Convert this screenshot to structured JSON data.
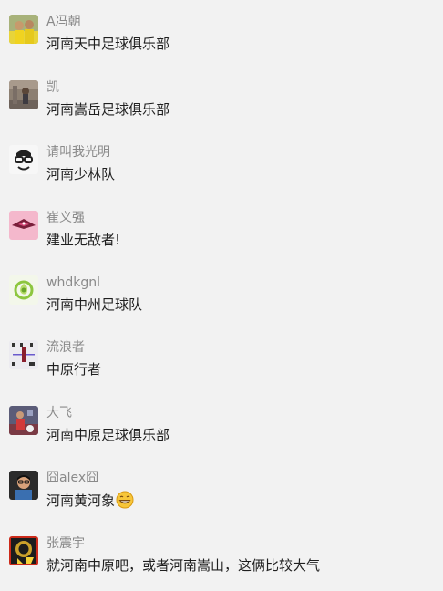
{
  "comments": [
    {
      "name": "A冯朝",
      "text": "河南天中足球俱乐部",
      "avatar_icon": "avatar-two-people-yellow"
    },
    {
      "name": "凯",
      "text": "河南嵩岳足球俱乐部",
      "avatar_icon": "avatar-person-photo"
    },
    {
      "name": "请叫我光明",
      "text": "河南少林队",
      "avatar_icon": "avatar-glasses-cartoon"
    },
    {
      "name": "崔义强",
      "text": "建业无敌者!",
      "avatar_icon": "avatar-pink-bird"
    },
    {
      "name": "whdkgnl",
      "text": "河南中州足球队",
      "avatar_icon": "avatar-green-logo"
    },
    {
      "name": "流浪者",
      "text": "中原行者",
      "avatar_icon": "avatar-chart-sheet"
    },
    {
      "name": "大飞",
      "text": "河南中原足球俱乐部",
      "avatar_icon": "avatar-soccer-photo"
    },
    {
      "name": "囧alex囧",
      "text": "河南黄河象",
      "avatar_icon": "avatar-man-photo",
      "emoji": "grin-emoji"
    },
    {
      "name": "张震宇",
      "text": "就河南中原吧，或者河南嵩山，这俩比较大气",
      "avatar_icon": "avatar-badge-70"
    }
  ]
}
